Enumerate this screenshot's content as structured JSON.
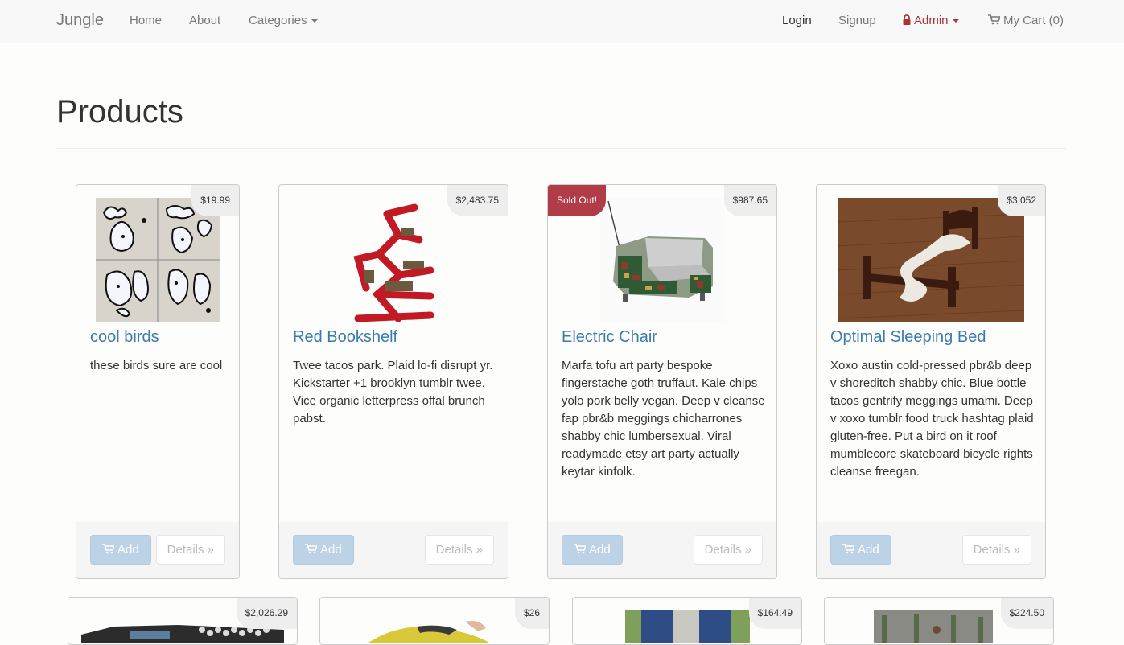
{
  "navbar": {
    "brand": "Jungle",
    "home": "Home",
    "about": "About",
    "categories": "Categories",
    "login": "Login",
    "signup": "Signup",
    "admin": "Admin",
    "cart": "My Cart (0)"
  },
  "page": {
    "title": "Products"
  },
  "buttons": {
    "add": "Add",
    "details": "Details »"
  },
  "products": [
    {
      "name": "cool birds",
      "price": "$19.99",
      "description": "these birds sure are cool"
    },
    {
      "name": "Red Bookshelf",
      "price": "$2,483.75",
      "description": "Twee tacos park. Plaid lo-fi disrupt yr. Kickstarter +1 brooklyn tumblr twee. Vice organic letterpress offal brunch pabst."
    },
    {
      "name": "Electric Chair",
      "price": "$987.65",
      "badge": "Sold Out!",
      "description": "Marfa tofu art party bespoke fingerstache goth truffaut. Kale chips yolo pork belly vegan. Deep v cleanse fap pbr&b meggings chicharrones shabby chic lumbersexual. Viral readymade etsy art party actually keytar kinfolk."
    },
    {
      "name": "Optimal Sleeping Bed",
      "price": "$3,052",
      "description": "Xoxo austin cold-pressed pbr&b deep v shoreditch shabby chic. Blue bottle tacos gentrify meggings umami. Deep v xoxo tumblr food truck hashtag plaid gluten-free. Put a bird on it roof mumblecore skateboard bicycle rights cleanse freegan."
    }
  ],
  "products_row2": [
    {
      "price": "$2,026.29"
    },
    {
      "price": "$26"
    },
    {
      "price": "$164.49"
    },
    {
      "price": "$224.50"
    }
  ],
  "colors": {
    "link": "#3b7bb0",
    "sold_out": "#b23b48",
    "admin": "#a33",
    "add_button": "#bcd2e6"
  }
}
